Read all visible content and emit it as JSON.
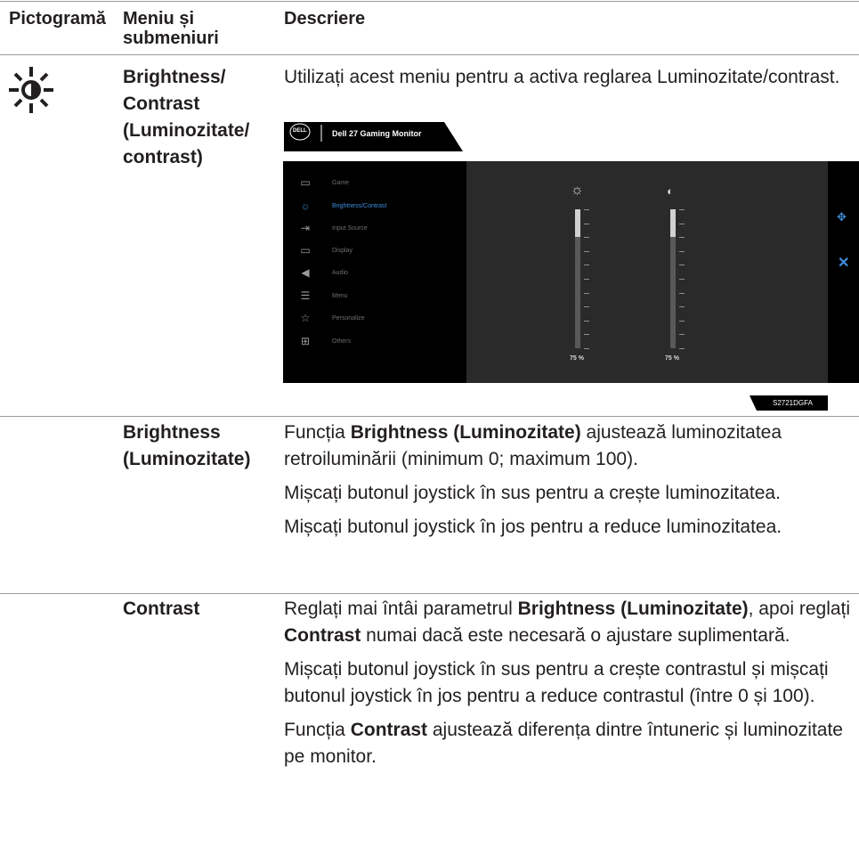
{
  "table": {
    "headers": {
      "icon": "Pictogramă",
      "menu": "Meniu și submeniuri",
      "desc": "Descriere"
    },
    "row1": {
      "icon": "sun-brightness-icon",
      "menu": "Brightness/ Contrast (Luminozitate/ contrast)",
      "desc": "Utilizați acest meniu pentru a activa reglarea Luminozitate/contrast."
    },
    "row2": {
      "menu": "Brightness (Luminozitate)",
      "p1_pre": "Funcția ",
      "p1_bold": "Brightness (Luminozitate)",
      "p1_post": " ajustează luminozitatea retroiluminării (minimum 0; maximum 100).",
      "p2": "Mișcați butonul joystick în sus pentru a crește luminozitatea.",
      "p3": "Mișcați butonul joystick în jos pentru a reduce luminozitatea."
    },
    "row3": {
      "menu": "Contrast",
      "p1_pre": "Reglați mai întâi parametrul ",
      "p1_bold1": "Brightness (Luminozitate)",
      "p1_mid": ", apoi reglați ",
      "p1_bold2": "Contrast",
      "p1_post": " numai dacă este necesară o ajustare suplimentară.",
      "p2": "Mișcați butonul joystick în sus pentru a crește contrastul și mișcați butonul joystick în jos pentru a reduce contrastul (între 0 și 100).",
      "p3_pre": "Funcția ",
      "p3_bold": "Contrast",
      "p3_post": " ajustează diferența dintre întuneric și luminozitate pe monitor."
    }
  },
  "osd": {
    "logo": "DELL",
    "title": "Dell 27 Gaming Monitor",
    "menu": [
      {
        "label": "Game",
        "icon": "game-icon"
      },
      {
        "label": "Brightness/Contrast",
        "icon": "brightness-icon"
      },
      {
        "label": "Input Source",
        "icon": "input-source-icon"
      },
      {
        "label": "Display",
        "icon": "display-icon"
      },
      {
        "label": "Audio",
        "icon": "audio-icon"
      },
      {
        "label": "Menu",
        "icon": "menu-icon"
      },
      {
        "label": "Personalize",
        "icon": "star-icon"
      },
      {
        "label": "Others",
        "icon": "others-icon"
      }
    ],
    "brightness_value": "75 %",
    "contrast_value": "75 %",
    "brightness_level": 0.2,
    "contrast_level": 0.2,
    "model": "S2721DGFA",
    "colors": {
      "accent": "#3e8ddd",
      "osd_bg": "#000000",
      "panel_bg": "#2a2a2a"
    }
  }
}
